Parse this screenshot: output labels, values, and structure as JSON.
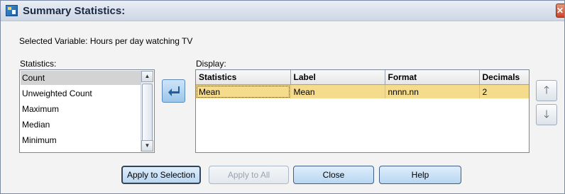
{
  "window": {
    "title": "Summary Statistics:",
    "close_glyph": "✕"
  },
  "selected_variable": "Selected Variable: Hours per day watching TV",
  "statistics_label": "Statistics:",
  "display_label": "Display:",
  "statistics_list": {
    "items": [
      "Count",
      "Unweighted Count",
      "Maximum",
      "Median",
      "Minimum"
    ],
    "selected": "Count"
  },
  "move_button_icon": "arrow-left-icon",
  "display_table": {
    "headers": [
      "Statistics",
      "Label",
      "Format",
      "Decimals"
    ],
    "rows": [
      {
        "statistics": "Mean",
        "label": "Mean",
        "format": "nnnn.nn",
        "decimals": "2"
      }
    ]
  },
  "reorder": {
    "up_icon": "arrow-up-icon",
    "down_icon": "arrow-down-icon",
    "up_glyph": "🡑",
    "down_glyph": "🡓"
  },
  "buttons": {
    "apply_selection": "Apply to Selection",
    "apply_all": "Apply to All",
    "close": "Close",
    "help": "Help"
  },
  "colors": {
    "selected_row": "#f5dc8c",
    "list_selection": "#d3d3d3",
    "title_bar": "#cdd6e4"
  }
}
